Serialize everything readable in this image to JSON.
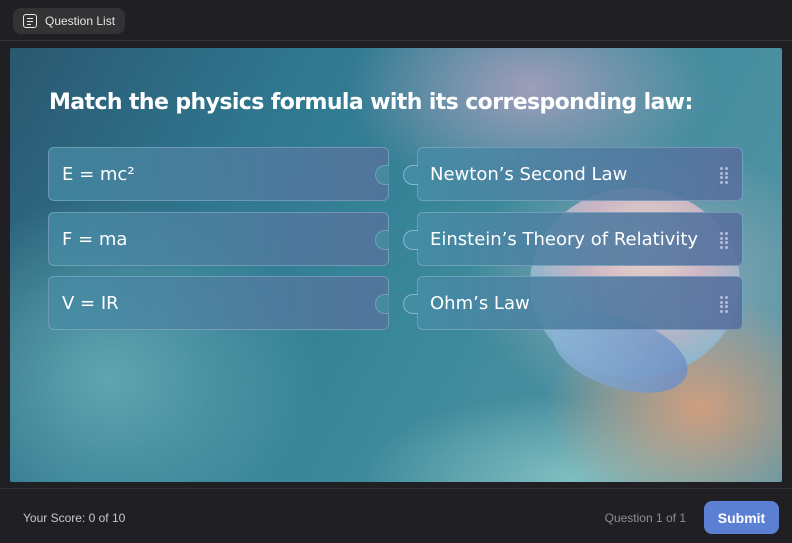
{
  "header": {
    "question_list_label": "Question List",
    "question_list_icon": "list-document-icon"
  },
  "quiz": {
    "question": "Match the physics formula with its corresponding law:",
    "formulas": [
      "E = mc²",
      "F = ma",
      "V = IR"
    ],
    "laws": [
      "Newton’s Second Law",
      "Einstein’s Theory of Relativity",
      "Ohm’s Law"
    ],
    "handle_icon": "drag-handle-icon"
  },
  "footer": {
    "score": "Your Score: 0 of 10",
    "question_count": "Question 1 of 1",
    "submit_label": "Submit"
  },
  "colors": {
    "background": "#202024",
    "submit": "#5b7fd3",
    "card_text": "#ffffff"
  }
}
